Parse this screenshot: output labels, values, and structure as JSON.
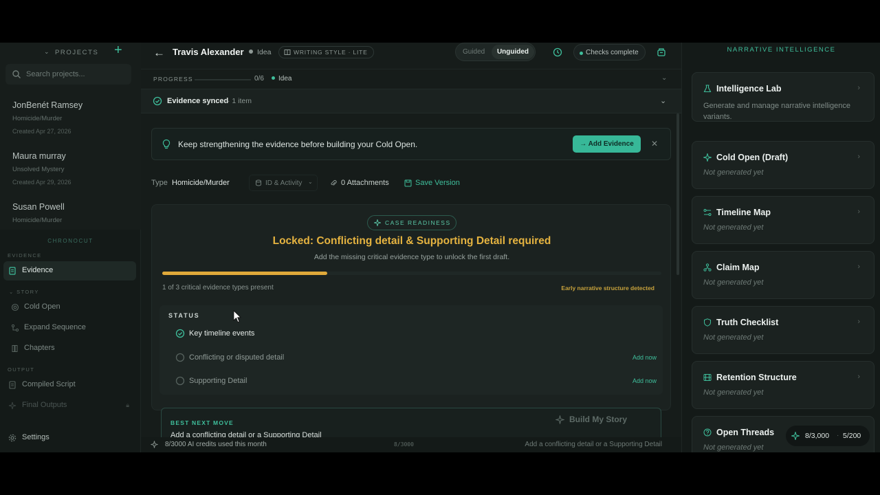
{
  "sidebar": {
    "projects_label": "PROJECTS",
    "search_placeholder": "Search projects...",
    "projects": [
      {
        "name": "JonBenét Ramsey",
        "type": "Homicide/Murder",
        "created": "Created Apr 27, 2026"
      },
      {
        "name": "Maura murray",
        "type": "Unsolved Mystery",
        "created": "Created Apr 29, 2026"
      },
      {
        "name": "Susan Powell",
        "type": "Homicide/Murder"
      }
    ],
    "brand": "CHRONOCUT",
    "sections": {
      "evidence": "EVIDENCE",
      "story": "STORY",
      "output": "OUTPUT"
    },
    "nav": {
      "evidence": "Evidence",
      "cold_open": "Cold Open",
      "expand_sequence": "Expand Sequence",
      "chapters": "Chapters",
      "compiled_script": "Compiled Script",
      "final_outputs": "Final Outputs",
      "settings": "Settings"
    }
  },
  "header": {
    "title": "Travis Alexander",
    "stage": "Idea",
    "writing_style": "WRITING STYLE · LITE",
    "mode_guided": "Guided",
    "mode_unguided": "Unguided",
    "checks": "Checks complete"
  },
  "progress": {
    "label": "PROGRESS",
    "count": "0/6",
    "stage": "Idea",
    "fraction": 0
  },
  "evidence_sync": {
    "label": "Evidence synced",
    "count": "· 1 item"
  },
  "banner": {
    "text": "Keep strengthening the evidence before building your Cold Open.",
    "button": "→ Add Evidence"
  },
  "meta": {
    "type_label": "Type",
    "type_value": "Homicide/Murder",
    "category": "ID & Activity",
    "attachments": "0 Attachments",
    "save_version": "Save Version"
  },
  "readiness": {
    "pill": "CASE READINESS",
    "title": "Locked: Conflicting detail & Supporting Detail required",
    "subtitle": "Add the missing critical evidence type to unlock the first draft.",
    "fill_fraction": 0.33,
    "present": "1 of 3 critical evidence types present",
    "badge": "Early narrative structure detected",
    "status_title": "STATUS",
    "items": [
      {
        "label": "Key timeline events",
        "done": true,
        "action": ""
      },
      {
        "label": "Conflicting or disputed detail",
        "done": false,
        "action": "Add now"
      },
      {
        "label": "Supporting Detail",
        "done": false,
        "action": "Add now"
      }
    ]
  },
  "next_move": {
    "label": "BEST NEXT MOVE",
    "text": "Add a conflicting detail or a Supporting Detail",
    "build": "Build My Story"
  },
  "footer": {
    "credits": "8/3000 AI credits used this month",
    "mid": "8/3000",
    "hint": "Add a conflicting detail or a Supporting Detail"
  },
  "right_panel": {
    "title": "NARRATIVE INTELLIGENCE",
    "cards": [
      {
        "name": "Intelligence Lab",
        "desc": "Generate and manage narrative intelligence variants.",
        "icon": "flask-icon"
      },
      {
        "name": "Cold Open (Draft)",
        "desc": "Not generated yet",
        "icon": "sparkle-icon"
      },
      {
        "name": "Timeline Map",
        "desc": "Not generated yet",
        "icon": "timeline-icon"
      },
      {
        "name": "Claim Map",
        "desc": "Not generated yet",
        "icon": "network-icon"
      },
      {
        "name": "Truth Checklist",
        "desc": "Not generated yet",
        "icon": "shield-icon"
      },
      {
        "name": "Retention Structure",
        "desc": "Not generated yet",
        "icon": "film-icon"
      },
      {
        "name": "Open Threads",
        "desc": "Not generated yet",
        "icon": "question-icon"
      }
    ],
    "credits_a": "8/3,000",
    "credits_sep": "·",
    "credits_b": "5/200"
  },
  "colors": {
    "accent": "#3fbf9c",
    "warning": "#e5b340",
    "background": "#121816"
  }
}
